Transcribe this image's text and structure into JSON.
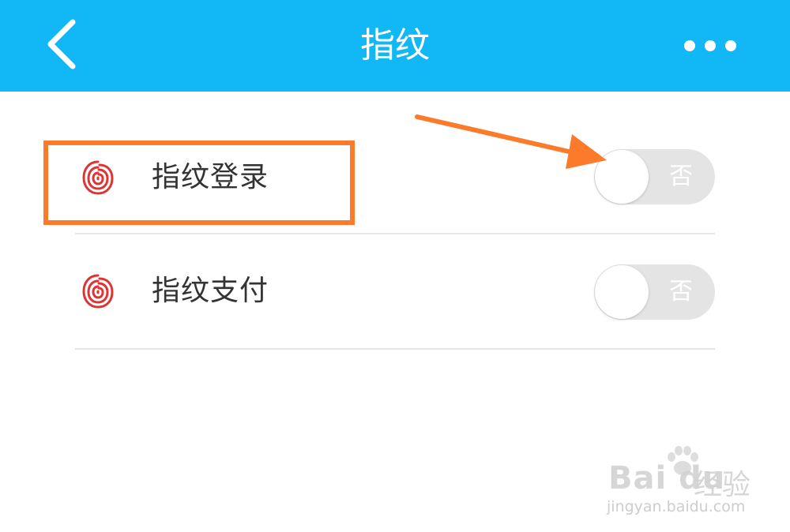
{
  "header": {
    "title": "指纹",
    "back_icon": "chevron-left-icon",
    "more_icon": "more-horizontal-icon",
    "background_color": "#12b7f5"
  },
  "settings": [
    {
      "icon": "fingerprint-icon",
      "label": "指纹登录",
      "toggle_text": "否",
      "enabled": false
    },
    {
      "icon": "fingerprint-icon",
      "label": "指纹支付",
      "toggle_text": "否",
      "enabled": false
    }
  ],
  "annotation": {
    "highlight_color": "#fb7b2b"
  },
  "watermark": {
    "brand": "Bai du",
    "product": "经验",
    "url": "jingyan.baidu.com"
  }
}
